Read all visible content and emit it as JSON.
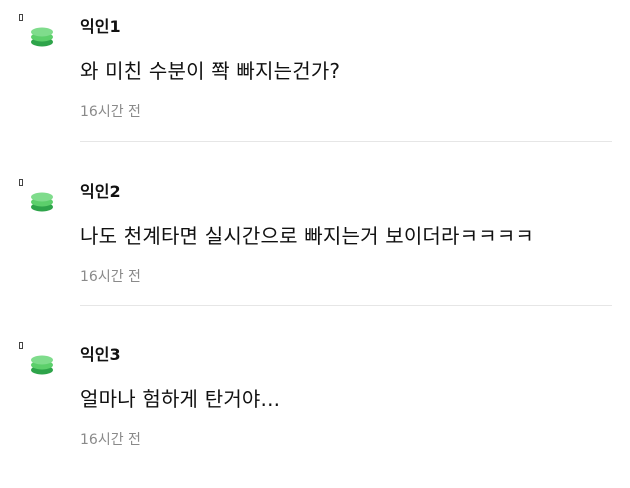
{
  "colors": {
    "avatar_green": "#5ccf6b",
    "avatar_dark": "#2ea44a",
    "time_gray": "#8a8a8a",
    "divider": "#e6e6e6"
  },
  "comments": [
    {
      "author": "익인1",
      "text": "와 미친 수분이 쫙 빠지는건가?",
      "time": "16시간 전",
      "avatar_icon": "green-leaf-stack-icon"
    },
    {
      "author": "익인2",
      "text": "나도 천계타면 실시간으로 빠지는거 보이더라ㅋㅋㅋㅋ",
      "time": "16시간 전",
      "avatar_icon": "green-leaf-stack-icon"
    },
    {
      "author": "익인3",
      "text": "얼마나 험하게 탄거야...",
      "time": "16시간 전",
      "avatar_icon": "green-leaf-stack-icon"
    }
  ]
}
